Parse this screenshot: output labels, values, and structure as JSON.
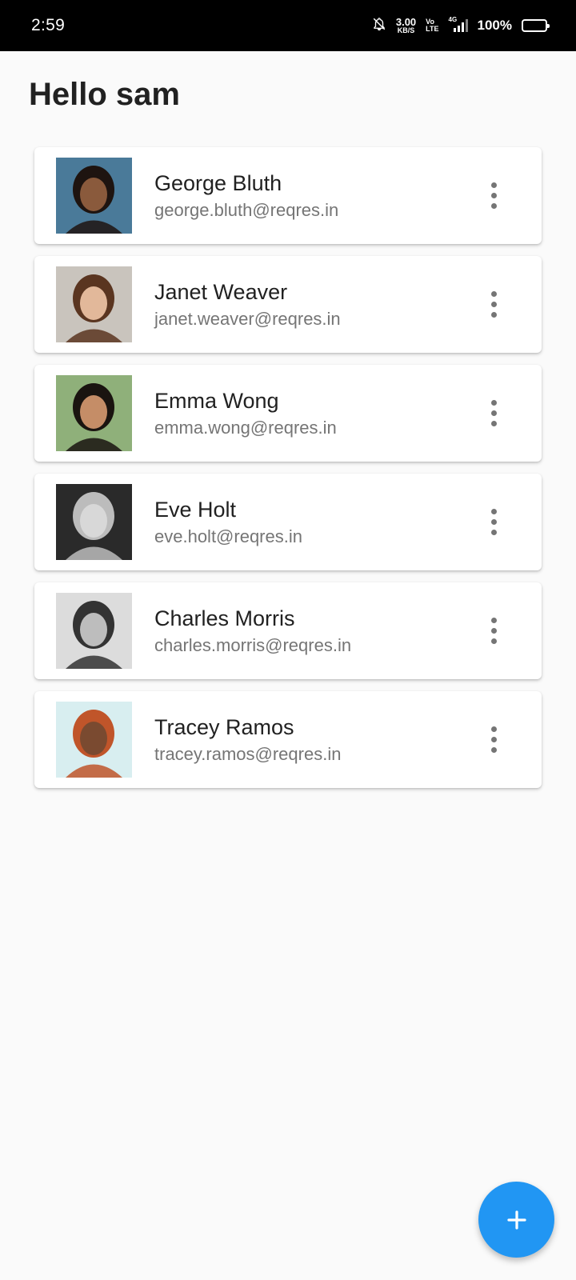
{
  "status_bar": {
    "time": "2:59",
    "net_speed_value": "3.00",
    "net_speed_unit": "KB/S",
    "volte_top": "Vo",
    "volte_bottom": "LTE",
    "network_type": "4G",
    "battery_percent": "100%",
    "icons": [
      "bell-muted-icon",
      "signal-icon",
      "battery-icon"
    ]
  },
  "header": {
    "title": "Hello sam"
  },
  "users": [
    {
      "name": "George Bluth",
      "email": "george.bluth@reqres.in",
      "avatar_bg": "#4a7a99",
      "skin": "#8a5a3c",
      "hair": "#1e1410"
    },
    {
      "name": "Janet Weaver",
      "email": "janet.weaver@reqres.in",
      "avatar_bg": "#c9c4bd",
      "skin": "#e2b89a",
      "hair": "#5a3520"
    },
    {
      "name": "Emma Wong",
      "email": "emma.wong@reqres.in",
      "avatar_bg": "#8fb07a",
      "skin": "#c58d67",
      "hair": "#1a1410"
    },
    {
      "name": "Eve Holt",
      "email": "eve.holt@reqres.in",
      "avatar_bg": "#2a2a2a",
      "skin": "#d8d8d8",
      "hair": "#bcbcbc"
    },
    {
      "name": "Charles Morris",
      "email": "charles.morris@reqres.in",
      "avatar_bg": "#dcdcdc",
      "skin": "#bdbdbd",
      "hair": "#333333"
    },
    {
      "name": "Tracey Ramos",
      "email": "tracey.ramos@reqres.in",
      "avatar_bg": "#d8eef0",
      "skin": "#7a4a30",
      "hair": "#c0552a"
    }
  ],
  "fab": {
    "icon": "add-icon",
    "color": "#2196f3"
  }
}
